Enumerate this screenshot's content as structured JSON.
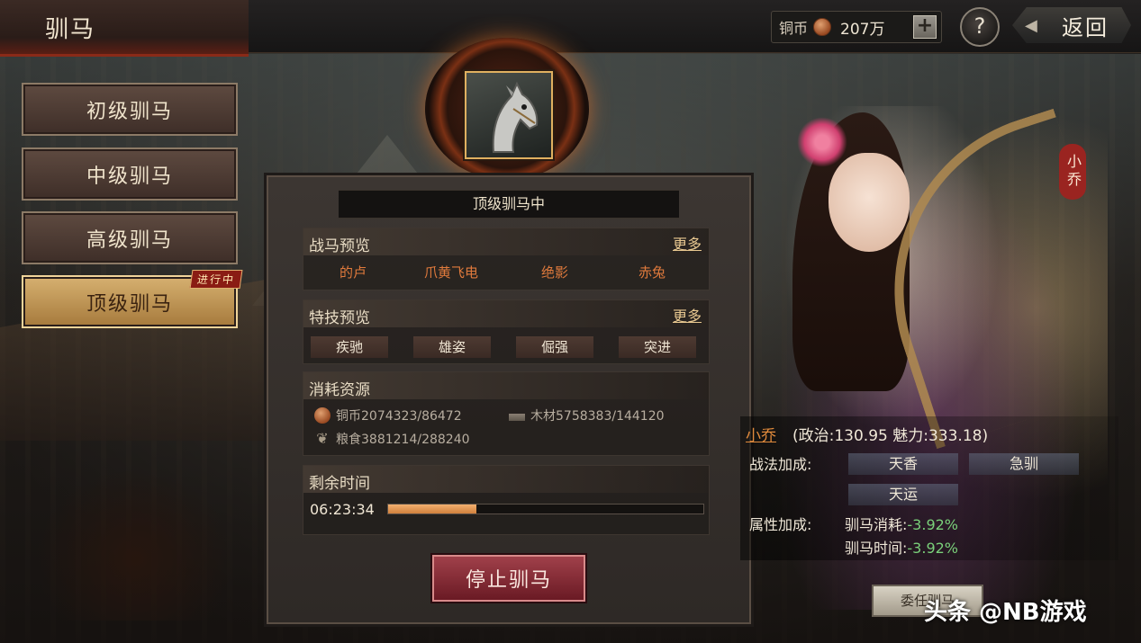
{
  "header": {
    "title": "驯马",
    "currency_label": "铜币",
    "currency_amount": "207万",
    "add_label": "+",
    "help_label": "?",
    "back_label": "返回",
    "back_arrow": "◀"
  },
  "tabs": [
    {
      "label": "初级驯马"
    },
    {
      "label": "中级驯马"
    },
    {
      "label": "高级驯马"
    },
    {
      "label": "顶级驯马",
      "badge": "进行中"
    }
  ],
  "panel": {
    "status": "顶级驯马中",
    "horse_preview": {
      "title": "战马预览",
      "more": "更多",
      "horses": [
        "的卢",
        "爪黄飞电",
        "绝影",
        "赤兔"
      ]
    },
    "skill_preview": {
      "title": "特技预览",
      "more": "更多",
      "skills": [
        "疾驰",
        "雄姿",
        "倔强",
        "突进"
      ]
    },
    "resources": {
      "title": "消耗资源",
      "copper": "铜币2074323/86472",
      "wood": "木材5758383/144120",
      "grain": "粮食3881214/288240",
      "grain_icon": "❦"
    },
    "time": {
      "title": "剩余时间",
      "value": "06:23:34",
      "progress": 0.28
    },
    "stop_button": "停止驯马"
  },
  "character": {
    "name_tag": "小乔",
    "name": "小乔",
    "stats": "(政治:130.95 魅力:333.18)",
    "tactic_label": "战法加成:",
    "tactics": [
      "天香",
      "急驯",
      "天运"
    ],
    "attr_label": "属性加成:",
    "attrs": [
      {
        "label": "驯马消耗:",
        "value": "-3.92%"
      },
      {
        "label": "驯马时间:",
        "value": "-3.92%"
      }
    ],
    "delegate_button": "委任驯马"
  },
  "watermark": "头条 @NB游戏",
  "colors": {
    "accent_orange": "#e08a3c",
    "bonus_green": "#7ad07a",
    "stop_red": "#8a2430"
  }
}
